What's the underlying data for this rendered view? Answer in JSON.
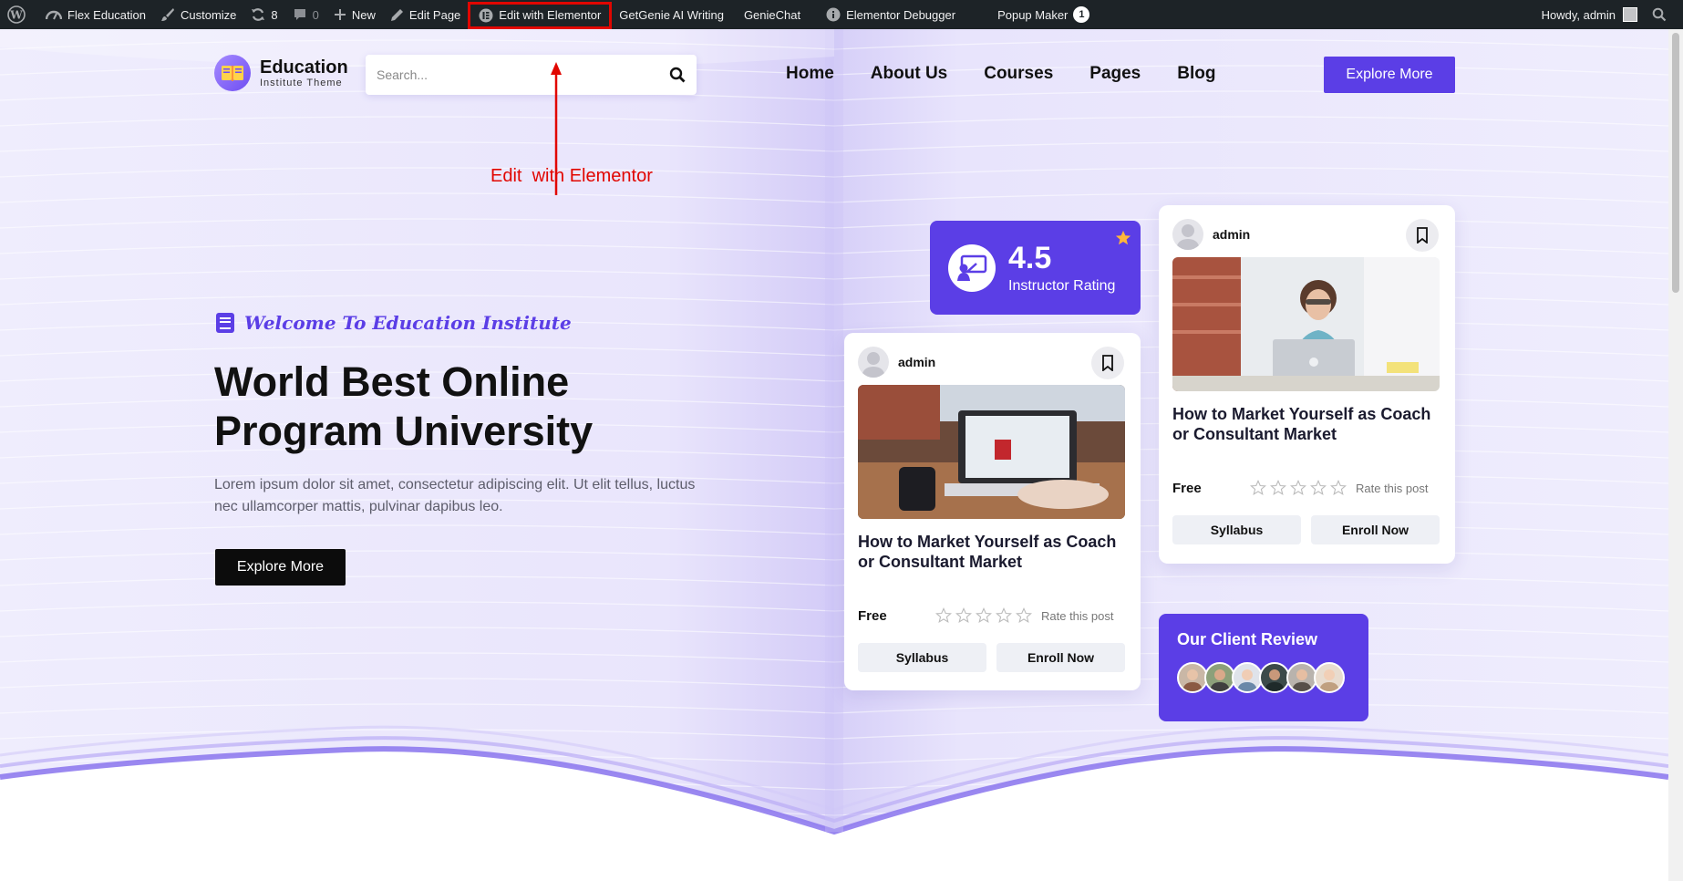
{
  "adminbar": {
    "site_name": "Flex Education",
    "customize": "Customize",
    "updates": "8",
    "comments": "0",
    "new": "New",
    "edit_page": "Edit Page",
    "edit_elementor": "Edit with Elementor",
    "getgenie": "GetGenie AI Writing",
    "geniechat": "GenieChat",
    "debugger": "Elementor Debugger",
    "popup_maker": "Popup Maker",
    "popup_count": "1",
    "howdy": "Howdy, admin"
  },
  "annotation": {
    "text": "Edit  with Elementor",
    "color": "#e10600"
  },
  "header": {
    "logo_title": "Education",
    "logo_sub": "Institute Theme",
    "search_placeholder": "Search...",
    "nav": [
      "Home",
      "About Us",
      "Courses",
      "Pages",
      "Blog"
    ],
    "cta": "Explore More"
  },
  "hero": {
    "welcome": "Welcome To Education Institute",
    "headline_line1": "World Best Online",
    "headline_line2": "Program University",
    "lead": "Lorem ipsum dolor sit amet, consectetur adipiscing elit. Ut elit tellus, luctus nec ullamcorper mattis, pulvinar dapibus leo.",
    "cta": "Explore More"
  },
  "rating_card": {
    "value": "4.5",
    "label": "Instructor Rating"
  },
  "courses": [
    {
      "author": "admin",
      "title": "How to Market Yourself as Coach or Consultant Market",
      "price": "Free",
      "rate_label": "Rate this post",
      "syllabus": "Syllabus",
      "enroll": "Enroll Now"
    },
    {
      "author": "admin",
      "title": "How to Market Yourself as Coach or Consultant Market",
      "price": "Free",
      "rate_label": "Rate this post",
      "syllabus": "Syllabus",
      "enroll": "Enroll Now"
    }
  ],
  "review_card": {
    "title": "Our Client Review"
  },
  "colors": {
    "accent": "#5b3ee6",
    "admin_bar": "#1d2327",
    "highlight": "#e10600"
  }
}
